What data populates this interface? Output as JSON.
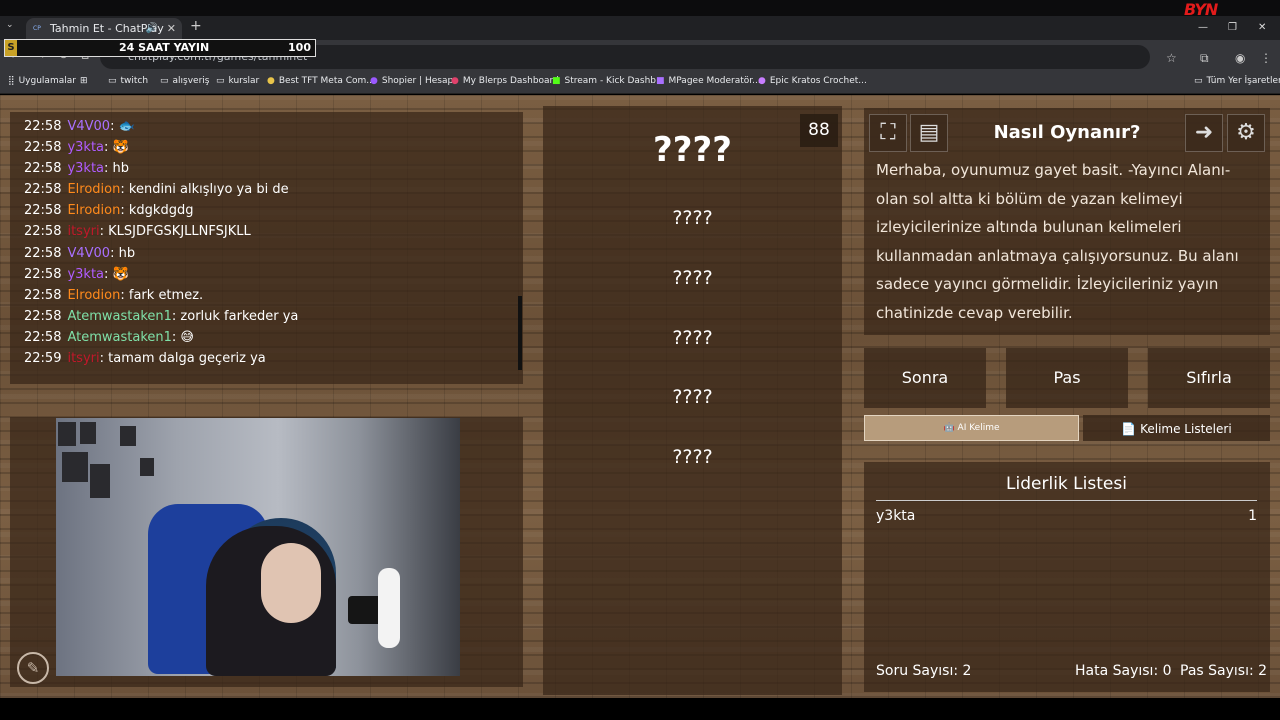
{
  "browser": {
    "tab_title": "Tahmin Et - ChatPlay",
    "tab_favicon": "CP",
    "url": "chatplay.com.tr/games/tahminet",
    "logo_text": "BYN"
  },
  "stream_overlay": {
    "badge": "S",
    "title": "24 SAAT YAYIN",
    "value": "100"
  },
  "bookmarks": [
    {
      "label": "Uygulamalar",
      "icon": "apps-icon"
    },
    {
      "label": "twitch",
      "icon": "folder-icon"
    },
    {
      "label": "alışveriş",
      "icon": "folder-icon"
    },
    {
      "label": "kurslar",
      "icon": "folder-icon"
    },
    {
      "label": "Best TFT Meta Com...",
      "icon": "site-icon"
    },
    {
      "label": "Shopier | Hesap",
      "icon": "site-icon"
    },
    {
      "label": "My Blerps Dashboard",
      "icon": "site-icon"
    },
    {
      "label": "Stream - Kick Dashb...",
      "icon": "kick-icon"
    },
    {
      "label": "MPagee Moderatör...",
      "icon": "twitch-icon"
    },
    {
      "label": "Epic Kratos Crochet...",
      "icon": "site-icon"
    },
    {
      "label": "Tüm Yer İşaretleri",
      "icon": "folder-icon"
    }
  ],
  "chat": [
    {
      "time": "22:58",
      "user": "V4V00",
      "color": "#a970ff",
      "text": "🐟"
    },
    {
      "time": "22:58",
      "user": "y3kta",
      "color": "#b05cff",
      "text": "🐯"
    },
    {
      "time": "22:58",
      "user": "y3kta",
      "color": "#b05cff",
      "text": "hb"
    },
    {
      "time": "22:58",
      "user": "Elrodion",
      "color": "#ff8a1c",
      "text": "kendini alkışlıyo ya bi de"
    },
    {
      "time": "22:58",
      "user": "Elrodion",
      "color": "#ff8a1c",
      "text": "kdgkdgdg"
    },
    {
      "time": "22:58",
      "user": "itsyri",
      "color": "#c0182a",
      "text": "KLSJDFGSKJLLNFSJKLL"
    },
    {
      "time": "22:58",
      "user": "V4V00",
      "color": "#a970ff",
      "text": "hb"
    },
    {
      "time": "22:58",
      "user": "y3kta",
      "color": "#b05cff",
      "text": "🐯"
    },
    {
      "time": "22:58",
      "user": "Elrodion",
      "color": "#ff8a1c",
      "text": "fark etmez."
    },
    {
      "time": "22:58",
      "user": "Atemwastaken1",
      "color": "#7fe0a8",
      "text": "zorluk farkeder ya"
    },
    {
      "time": "22:58",
      "user": "Atemwastaken1",
      "color": "#7fe0a8",
      "text": "😅"
    },
    {
      "time": "22:59",
      "user": "itsyri",
      "color": "#c0182a",
      "text": "tamam dalga geçeriz ya"
    }
  ],
  "game": {
    "counter": "88",
    "main_word": "????",
    "words": [
      "????",
      "????",
      "????",
      "????",
      "????"
    ]
  },
  "how_to": {
    "title": "Nasıl Oynanır?",
    "text": "Merhaba, oyunumuz gayet basit. -Yayıncı Alanı- olan sol altta ki bölüm de yazan kelimeyi izleyicilerinize altında bulunan kelimeleri kullanmadan anlatmaya çalışıyorsunuz. Bu alanı sadece yayıncı görmelidir. İzleyicileriniz yayın chatinizde cevap verebilir."
  },
  "controls": {
    "next": "Sonra",
    "pass": "Pas",
    "reset": "Sıfırla",
    "ai_word": "AI Kelime",
    "word_lists": "Kelime Listeleri"
  },
  "leaderboard": {
    "title": "Liderlik Listesi",
    "rows": [
      {
        "name": "y3kta",
        "score": "1"
      }
    ]
  },
  "stats": {
    "questions": "Soru Sayısı: 2",
    "errors": "Hata Sayısı: 0",
    "passes": "Pas Sayısı: 2"
  }
}
